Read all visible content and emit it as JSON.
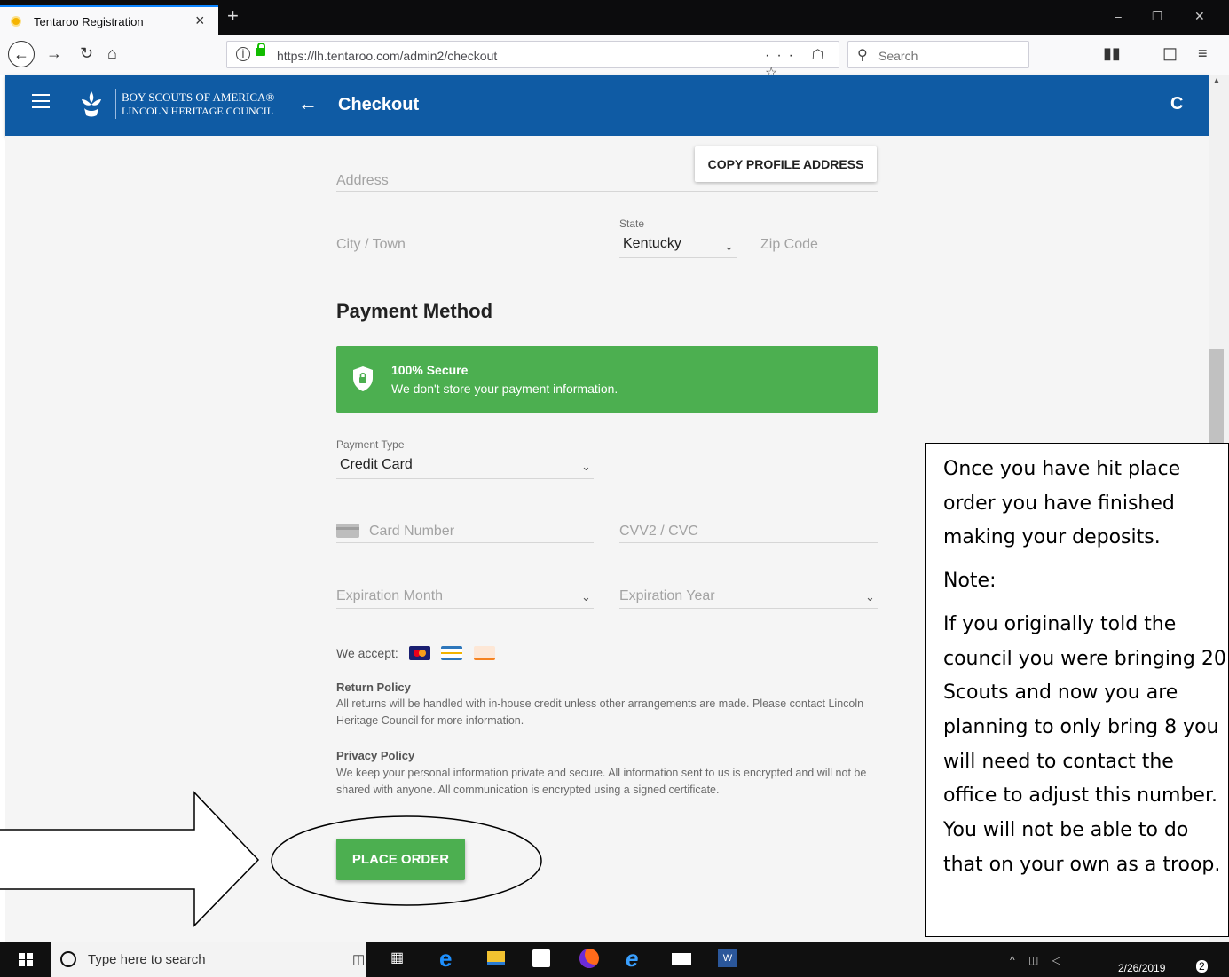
{
  "browser": {
    "tab_title": "Tentaroo Registration",
    "tab_close": "×",
    "new_tab": "+",
    "url": "https://lh.tentaroo.com/admin2/checkout",
    "url_actions": "··· ☖ ☆",
    "search_placeholder": "Search"
  },
  "header": {
    "org_line1": "BOY SCOUTS OF AMERICA®",
    "org_line2": "LINCOLN HERITAGE COUNCIL",
    "title": "Checkout",
    "back": "←",
    "refresh": "C"
  },
  "address": {
    "address_placeholder": "Address",
    "copy_button": "COPY PROFILE ADDRESS",
    "city_placeholder": "City / Town",
    "state_label": "State",
    "state_value": "Kentucky",
    "zip_placeholder": "Zip Code"
  },
  "payment": {
    "heading": "Payment Method",
    "secure_title": "100% Secure",
    "secure_text": "We don't store your payment information.",
    "type_label": "Payment Type",
    "type_value": "Credit Card",
    "card_number_placeholder": "Card Number",
    "cvv_placeholder": "CVV2 / CVC",
    "exp_month_placeholder": "Expiration Month",
    "exp_year_placeholder": "Expiration Year",
    "accept_label": "We accept:",
    "accepted_cards": [
      "mastercard-icon",
      "amex-icon",
      "discover-icon"
    ],
    "return_title": "Return Policy",
    "return_text": "All returns will be handled with in-house credit unless other arrangements are made. Please contact Lincoln Heritage Council for more information.",
    "privacy_title": "Privacy Policy",
    "privacy_text": "We keep your personal information private and secure. All information sent to us is encrypted and will not be shared with anyone. All communication is encrypted using a signed certificate.",
    "place_order": "PLACE ORDER"
  },
  "annotation": {
    "p1": "Once you have hit place order you have finished making your deposits.",
    "p2": "Note:",
    "p3": "If you originally told the council you were bringing 20 Scouts and now you are planning to only bring 8 you will need to contact the office to adjust this number.  You will not be able to do that on your own as a troop."
  },
  "taskbar": {
    "search_placeholder": "Type here to search",
    "date": "2/26/2019",
    "notifications": "2"
  },
  "colors": {
    "brand_blue": "#0f5ba4",
    "success_green": "#4caf50",
    "content_bg": "#f5f5f5"
  }
}
